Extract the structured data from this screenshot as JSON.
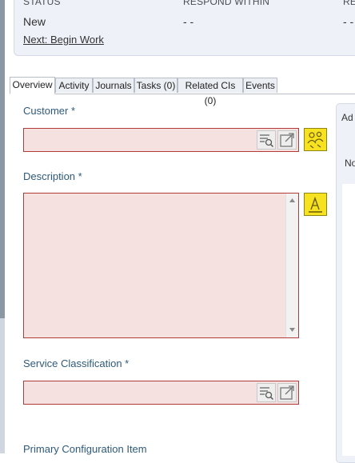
{
  "header": {
    "status_label": "STATUS",
    "status_value": "New",
    "respond_label": "RESPOND WITHIN",
    "respond_value": "- -",
    "third_label": "RE",
    "third_value": "- -",
    "next_link": "Next: Begin Work"
  },
  "tabs": [
    {
      "label": "Overview",
      "active": true
    },
    {
      "label": "Activity"
    },
    {
      "label": "Journals"
    },
    {
      "label": "Tasks (0)"
    },
    {
      "label": "Related CIs (0)"
    },
    {
      "label": "Events"
    }
  ],
  "form": {
    "customer_label": "Customer *",
    "description_label": "Description *",
    "service_label": "Service Classification *",
    "primary_ci_label": "Primary Configuration Item"
  },
  "side_panel": {
    "title": "Ad",
    "text": "No"
  },
  "colors": {
    "required_field_bg": "#f6e1e1",
    "required_field_border": "#b33a3a",
    "label_color": "#2e5a7a",
    "action_button": "#f6e221"
  }
}
